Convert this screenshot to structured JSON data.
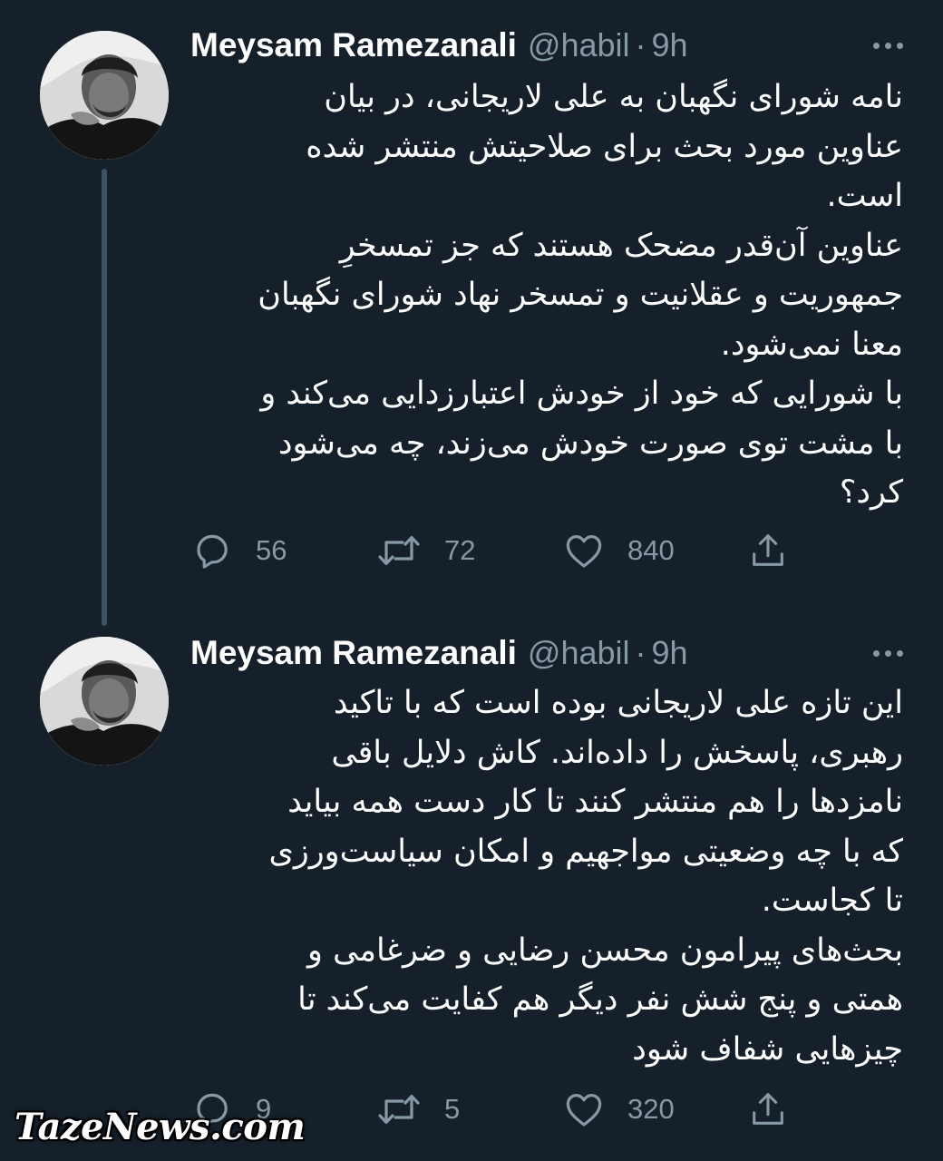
{
  "tweets": [
    {
      "name": "Meysam Ramezanali",
      "handle": "@habil",
      "separator": "·",
      "time": "9h",
      "lines": [
        "نامه شورای نگهبان به علی لاریجانی، در بیان",
        "عناوین مورد بحث برای صلاحیتش منتشر شده",
        "است.",
        "عناوین آن‌قدر مضحک هستند که جز تمسخرِ",
        "جمهوریت و عقلانیت و تمسخر نهاد شورای نگهبان",
        "معنا نمی‌شود.",
        "با شورایی که خود از خودش اعتبارزدایی می‌کند و",
        "با مشت توی صورت خودش می‌زند، چه می‌شود",
        "کرد؟"
      ],
      "replies": "56",
      "retweets": "72",
      "likes": "840"
    },
    {
      "name": "Meysam Ramezanali",
      "handle": "@habil",
      "separator": "·",
      "time": "9h",
      "lines": [
        "این تازه علی لاریجانی بوده است که با تاکید",
        "رهبری، پاسخش را داده‌اند. کاش دلایل باقی",
        "نامزدها را هم منتشر کنند تا کار دست همه بیاید",
        "که با چه وضعیتی مواجهیم و امکان سیاست‌ورزی",
        "تا کجاست.",
        "بحث‌های پیرامون محسن رضایی و ضرغامی و",
        "همتی و پنج شش نفر دیگر هم کفایت می‌کند تا",
        "چیزهایی شفاف شود"
      ],
      "replies": "9",
      "retweets": "5",
      "likes": "320"
    }
  ],
  "icons": {
    "reply": "reply-icon",
    "retweet": "retweet-icon",
    "like": "like-icon",
    "share": "share-icon",
    "more": "more-icon"
  },
  "colors": {
    "background": "#15202b",
    "secondary_text": "#8899a6",
    "thread_line": "#3d5466"
  },
  "watermark": "TazeNews.com"
}
